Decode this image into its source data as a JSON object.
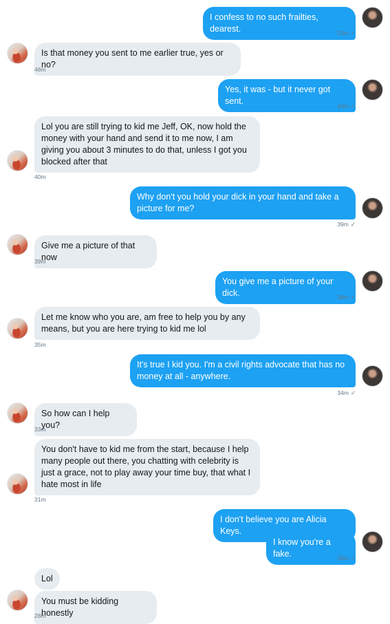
{
  "messages": [
    {
      "from": "me",
      "text": "I confess to no such frailties, dearest.",
      "time": "53m",
      "check": "✓"
    },
    {
      "from": "them",
      "text": "Is that money you sent to me earlier true, yes or no?",
      "time": "46m"
    },
    {
      "from": "me",
      "text": "Yes, it was - but it never got sent.",
      "time": "44m",
      "check": "✓"
    },
    {
      "from": "them",
      "text": "Lol you are still trying to kid me Jeff, OK, now hold the money with your hand and send it to me now, I am giving you about 3 minutes to do that, unless I got you blocked after that",
      "time": "40m"
    },
    {
      "from": "me",
      "text": "Why don't you hold your dick in your hand and take a picture for me?",
      "time": "39m",
      "check": "✓"
    },
    {
      "from": "them",
      "text": "Give me a picture of that now",
      "time": "39m"
    },
    {
      "from": "me",
      "text": "You give me a picture of your dick.",
      "time": "38m",
      "check": "✓"
    },
    {
      "from": "them",
      "text": "Let me know who you are, am free to help you by any means, but you are here trying to kid me lol",
      "time": "35m"
    },
    {
      "from": "me",
      "text": "It's true I kid you. I'm a civil rights advocate that has no money at all - anywhere.",
      "time": "34m",
      "check": "✓"
    },
    {
      "from": "them",
      "text": "So how can I help you?",
      "time": "33m"
    },
    {
      "from": "them",
      "text": "You don't have to kid me from the start, because I help many people out there, you chatting with celebrity is just a grace, not to play away your time buy, that what I hate most in life",
      "time": "31m"
    },
    {
      "from": "me",
      "text": "I don't believe you are Alicia Keys.",
      "time": ""
    },
    {
      "from": "me",
      "text": "I know you're a fake.",
      "time": "29m",
      "check": "✓"
    },
    {
      "from": "them",
      "text": "Lol",
      "time": ""
    },
    {
      "from": "them",
      "text": "You must be kidding honestly",
      "time": "28m"
    }
  ],
  "avatars": {
    "me": "user-avatar",
    "them": "contact-avatar"
  },
  "colors": {
    "outgoing_bubble": "#1da1f2",
    "incoming_bubble": "#e6ecf0",
    "timestamp": "#657786"
  }
}
